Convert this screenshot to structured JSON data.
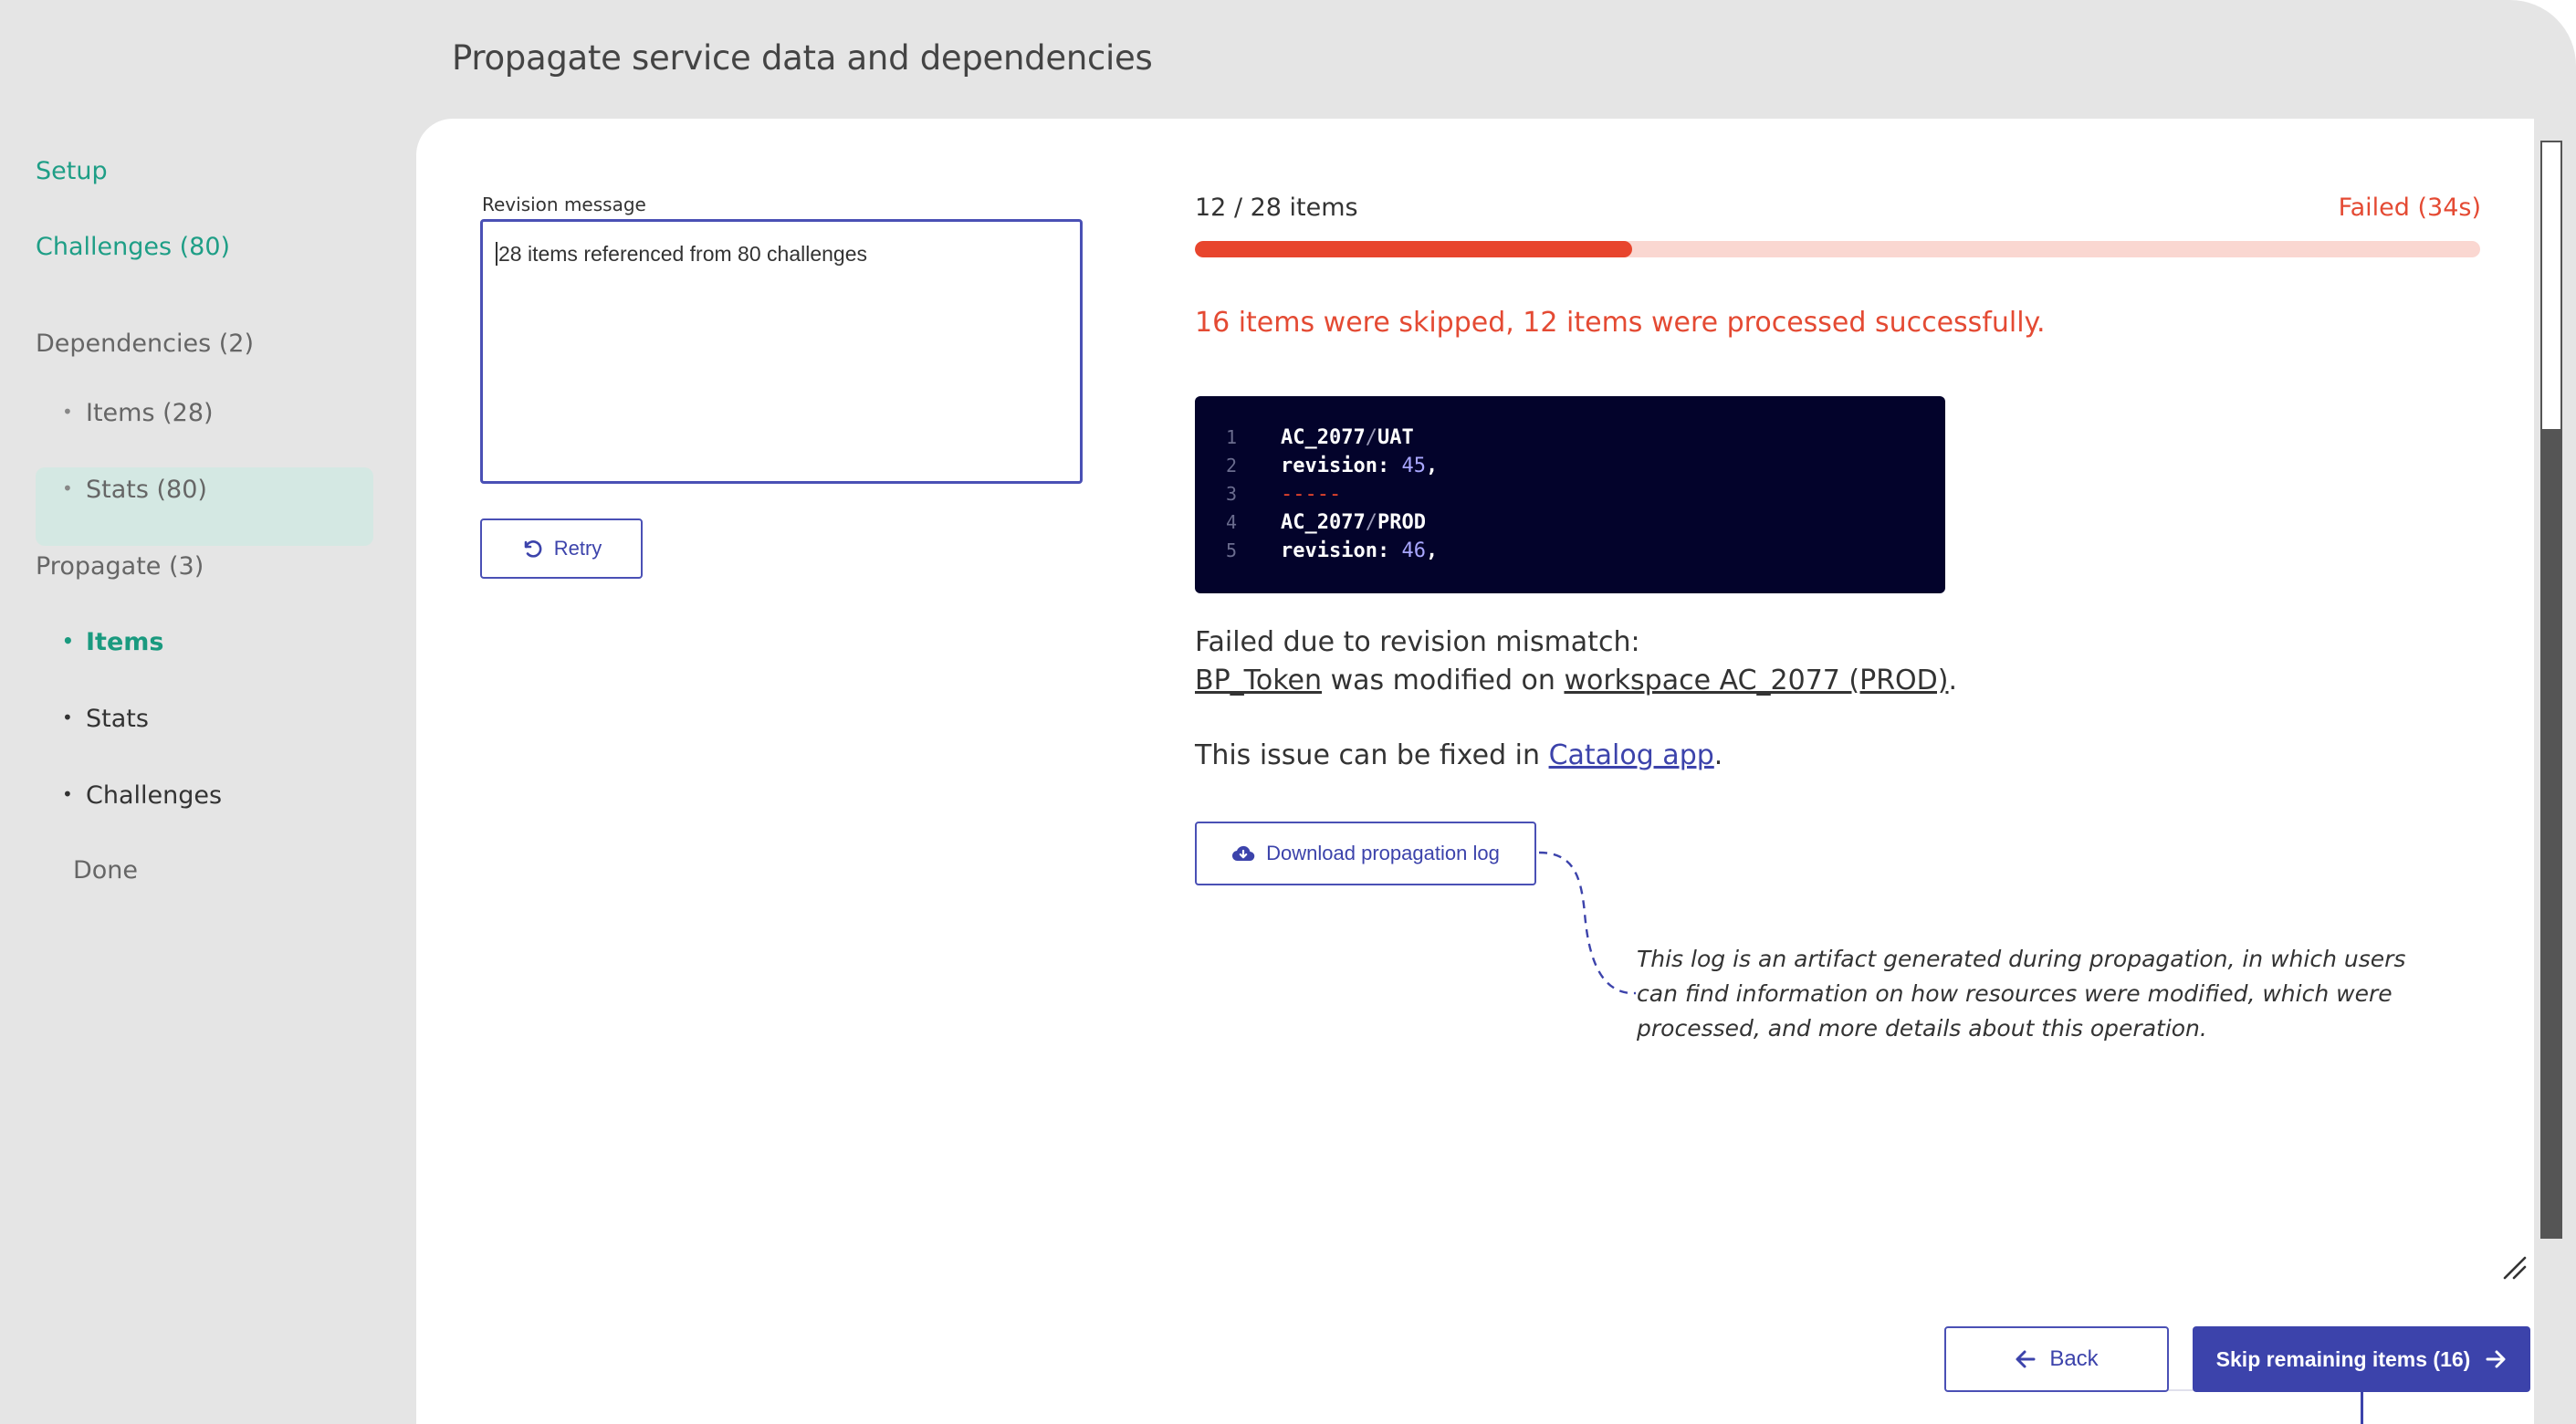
{
  "page": {
    "title": "Propagate service data and dependencies"
  },
  "sidebar": {
    "setup": "Setup",
    "challenges": "Challenges (80)",
    "dependencies": "Dependencies (2)",
    "dep_items": "Items (28)",
    "dep_stats": "Stats (80)",
    "propagate": "Propagate (3)",
    "prop_items": "Items",
    "prop_stats": "Stats",
    "prop_challenges": "Challenges",
    "done": "Done",
    "bullet": "•"
  },
  "revision": {
    "label": "Revision message",
    "value": "28 items referenced from 80 challenges",
    "retry_label": "Retry"
  },
  "progress": {
    "count_text": "12 / 28 items",
    "status_text": "Failed (34s)",
    "fraction": 0.34,
    "summary": "16 items were skipped, 12 items were processed successfully."
  },
  "code": {
    "lines": [
      {
        "n": "1",
        "a": "AC_2077",
        "sep": "/",
        "b": "UAT"
      },
      {
        "n": "2",
        "key": "revision: ",
        "num": "45",
        "tail": ","
      },
      {
        "n": "3",
        "dash": "-----"
      },
      {
        "n": "4",
        "a": "AC_2077",
        "sep": "/",
        "b": "PROD"
      },
      {
        "n": "5",
        "key": "revision: ",
        "num": "46",
        "tail": ","
      }
    ]
  },
  "error": {
    "line1": "Failed due to revision mismatch:",
    "token": "BP_Token",
    "modified_on": " was modified on ",
    "workspace": "workspace AC_2077 (PROD)",
    "period": ".",
    "fix_prefix": "This issue can be fixed in ",
    "fix_link": "Catalog app",
    "fix_suffix": "."
  },
  "download": {
    "label": "Download propagation log",
    "note": "This log is an artifact generated during propagation, in which users can find information on how resources were modified, which were processed, and more details about this operation."
  },
  "footer": {
    "back_label": "Back",
    "skip_label": "Skip remaining items (16)"
  },
  "colors": {
    "accent": "#3c43ab",
    "success": "#1e9e86",
    "error": "#e44a33",
    "code_bg": "#03032b"
  },
  "icons": [
    "retry-icon",
    "cloud-download-icon",
    "arrow-left-icon",
    "arrow-right-icon",
    "resize-handle-icon"
  ]
}
